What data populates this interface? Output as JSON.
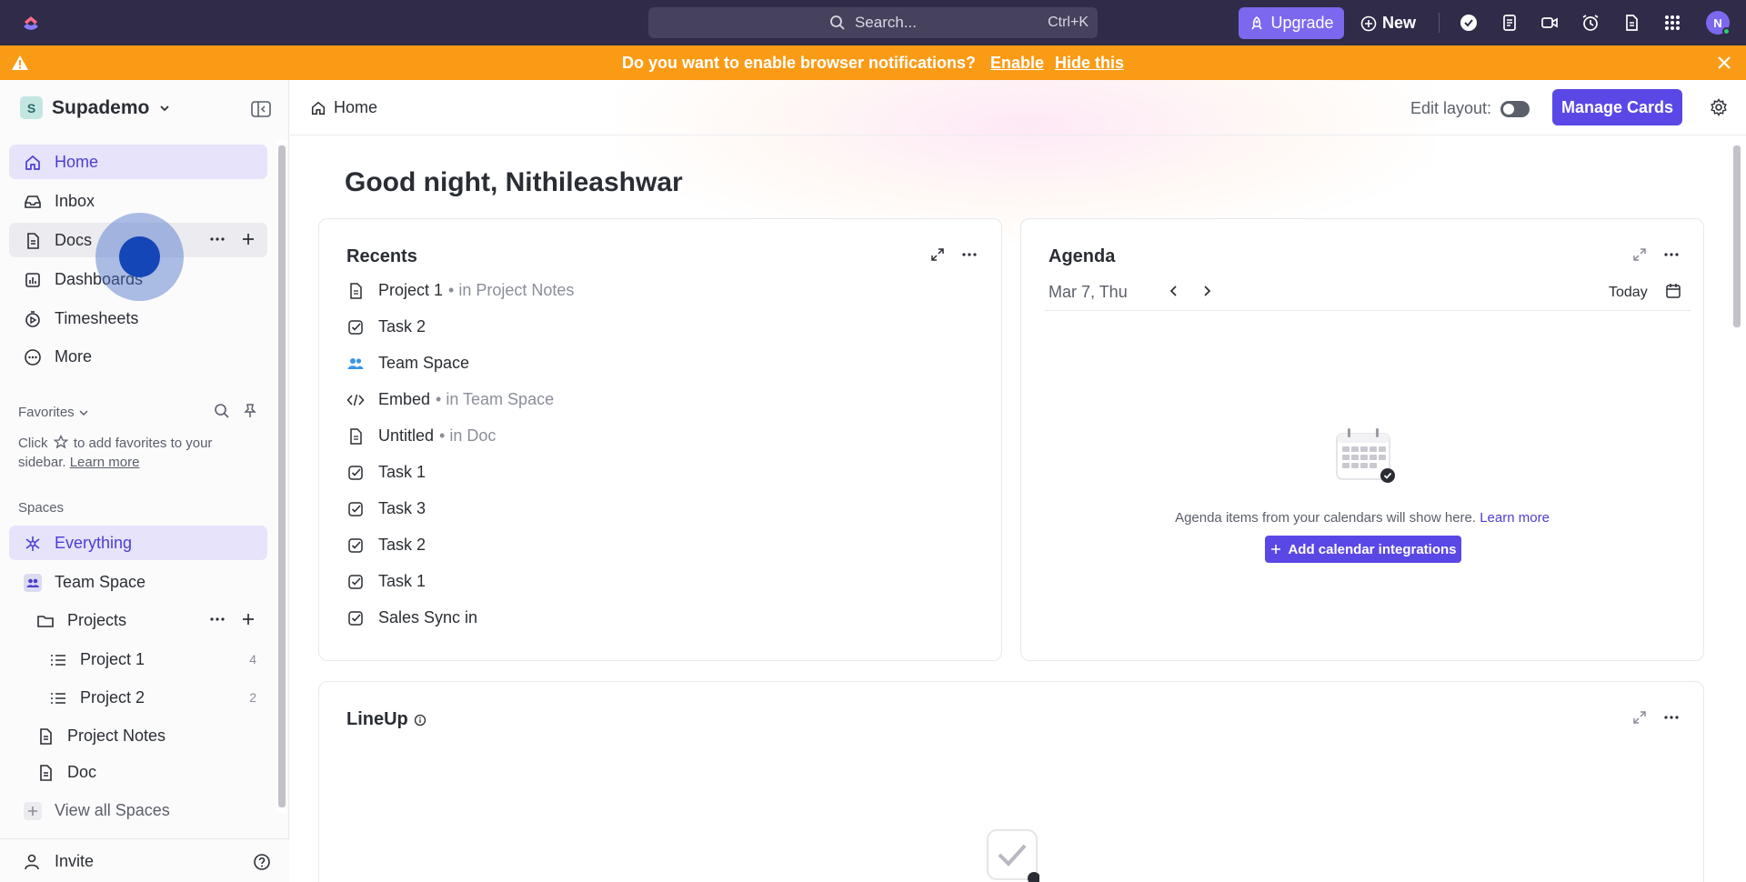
{
  "topbar": {
    "search_placeholder": "Search...",
    "search_shortcut": "Ctrl+K",
    "upgrade_label": "Upgrade",
    "new_label": "New",
    "avatar_initial": "N"
  },
  "notification": {
    "message": "Do you want to enable browser notifications?",
    "enable_label": "Enable",
    "hide_label": "Hide this"
  },
  "sidebar": {
    "workspace_initial": "S",
    "workspace_name": "Supademo",
    "nav": [
      {
        "label": "Home",
        "icon": "home-icon",
        "active": true
      },
      {
        "label": "Inbox",
        "icon": "inbox-icon"
      },
      {
        "label": "Docs",
        "icon": "doc-icon"
      },
      {
        "label": "Dashboards",
        "icon": "dashboard-icon"
      },
      {
        "label": "Timesheets",
        "icon": "timer-icon"
      },
      {
        "label": "More",
        "icon": "more-circle-icon"
      }
    ],
    "favorites": {
      "title": "Favorites",
      "hint_before": "Click",
      "hint_after": "to add favorites to your sidebar.",
      "learn_more": "Learn more"
    },
    "spaces": {
      "title": "Spaces",
      "items": [
        {
          "label": "Everything",
          "icon": "everything-icon"
        },
        {
          "label": "Team Space",
          "icon": "team-icon"
        },
        {
          "label": "Projects",
          "icon": "folder-icon"
        },
        {
          "label": "Project 1",
          "icon": "list-icon",
          "count": "4"
        },
        {
          "label": "Project 2",
          "icon": "list-icon",
          "count": "2"
        },
        {
          "label": "Project Notes",
          "icon": "doc-icon"
        },
        {
          "label": "Doc",
          "icon": "doc-icon"
        },
        {
          "label": "View all Spaces",
          "icon": "plus-icon"
        }
      ]
    },
    "invite_label": "Invite"
  },
  "header": {
    "breadcrumb": "Home",
    "edit_layout_label": "Edit layout:",
    "manage_cards_label": "Manage Cards"
  },
  "greeting": "Good night, Nithileashwar",
  "recents": {
    "title": "Recents",
    "items": [
      {
        "name": "Project 1",
        "location": "• in Project Notes",
        "icon": "doc-icon"
      },
      {
        "name": "Task 2",
        "location": "",
        "icon": "task-check-icon"
      },
      {
        "name": "Team Space",
        "location": "",
        "icon": "team-icon"
      },
      {
        "name": "Embed",
        "location": "• in Team Space",
        "icon": "code-icon"
      },
      {
        "name": "Untitled",
        "location": "• in Doc",
        "icon": "doc-icon"
      },
      {
        "name": "Task 1",
        "location": "",
        "icon": "task-check-icon"
      },
      {
        "name": "Task 3",
        "location": "",
        "icon": "task-check-icon"
      },
      {
        "name": "Task 2",
        "location": "",
        "icon": "task-check-icon"
      },
      {
        "name": "Task 1",
        "location": "",
        "icon": "task-check-icon"
      },
      {
        "name": "Sales Sync in",
        "location": "",
        "icon": "task-check-icon"
      }
    ]
  },
  "agenda": {
    "title": "Agenda",
    "date": "Mar 7, Thu",
    "today_label": "Today",
    "empty_text": "Agenda items from your calendars will show here.",
    "learn_more": "Learn more",
    "add_button": "Add calendar integrations"
  },
  "lineup": {
    "title": "LineUp"
  },
  "colors": {
    "topbar": "#2f2b48",
    "notice": "#fa9b16",
    "accent": "#5a48e6"
  }
}
